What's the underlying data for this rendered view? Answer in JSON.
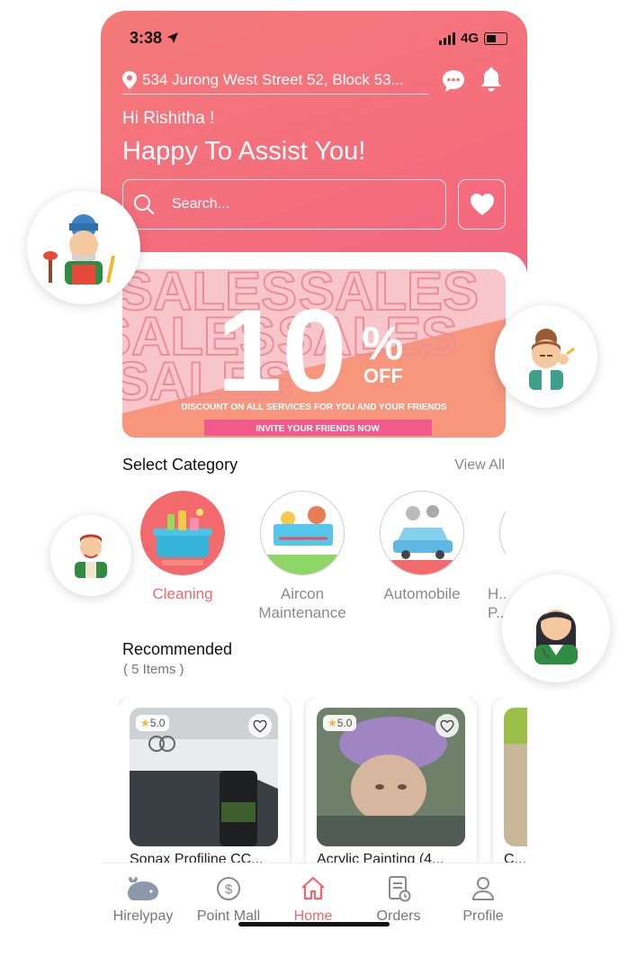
{
  "status": {
    "time": "3:38",
    "network": "4G"
  },
  "header": {
    "location": "534 Jurong West Street 52, Block 53...",
    "greeting": "Hi Rishitha !",
    "headline": "Happy To Assist You!",
    "search_placeholder": "Search..."
  },
  "banner": {
    "bg_word": "SALES",
    "big_number": "10",
    "percent": "%",
    "off": "OFF",
    "discount_text": "DISCOUNT ON ALL SERVICES FOR YOU AND YOUR FRIENDS",
    "cta": "INVITE YOUR FRIENDS NOW"
  },
  "categories": {
    "title": "Select Category",
    "view_all": "View All",
    "items": [
      {
        "label": "Cleaning",
        "active": true
      },
      {
        "label": "Aircon Maintenance",
        "active": false
      },
      {
        "label": "Automobile",
        "active": false
      },
      {
        "label": "H... P...",
        "active": false
      }
    ]
  },
  "recommended": {
    "title": "Recommended",
    "count": "( 5 Items )",
    "items": [
      {
        "title": "Sonax Profiline CC...",
        "rating": "5.0"
      },
      {
        "title": "Acrylic Painting (4...",
        "rating": "5.0"
      },
      {
        "title": "C...",
        "rating": ""
      }
    ]
  },
  "tabs": [
    {
      "label": "Hirelypay",
      "icon": "whale-icon"
    },
    {
      "label": "Point Mall",
      "icon": "dollar-coin-icon"
    },
    {
      "label": "Home",
      "icon": "home-icon",
      "active": true
    },
    {
      "label": "Orders",
      "icon": "orders-icon"
    },
    {
      "label": "Profile",
      "icon": "profile-icon"
    }
  ],
  "colors": {
    "accent": "#f2666f",
    "header": "#f47478",
    "banner_peach": "#f7957b",
    "banner_pink": "#f7c3c8"
  }
}
